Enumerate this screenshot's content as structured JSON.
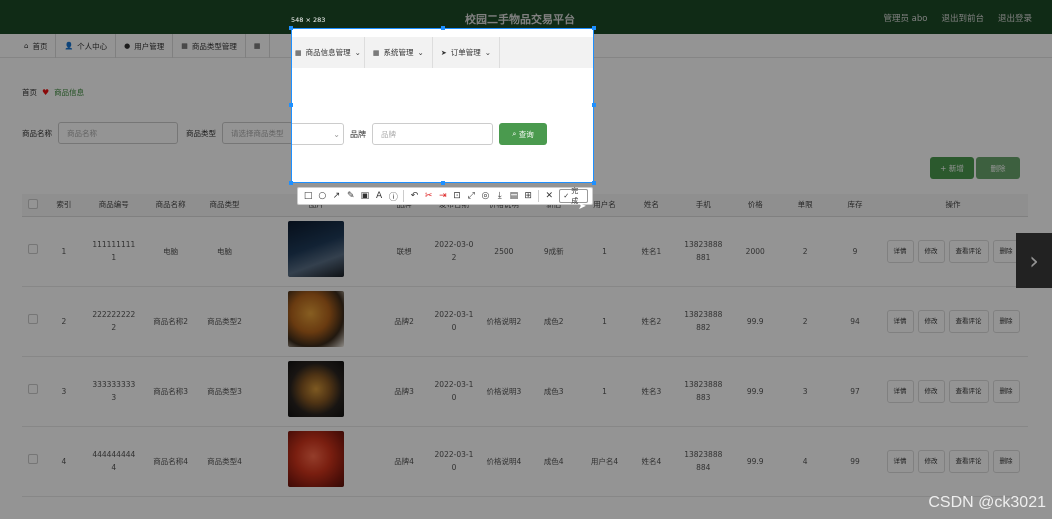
{
  "app": {
    "title": "校园二手物品交易平台",
    "admin_label": "管理员 abo",
    "exit_front_label": "退出到前台",
    "logout_label": "退出登录"
  },
  "nav": {
    "items": [
      {
        "icon": "⌂",
        "label": "首页"
      },
      {
        "icon": "👤",
        "label": "个人中心"
      },
      {
        "icon": "●",
        "label": "用户管理"
      },
      {
        "icon": "▦",
        "label": "商品类型管理"
      },
      {
        "icon": "▦",
        "label": "商品信息管理"
      },
      {
        "icon": "▦",
        "label": "系统管理"
      },
      {
        "icon": "➤",
        "label": "订单管理"
      }
    ]
  },
  "breadcrumb": {
    "home": "首页",
    "current": "商品信息"
  },
  "search": {
    "name_label": "商品名称",
    "name_placeholder": "商品名称",
    "type_label": "商品类型",
    "type_placeholder": "请选择商品类型",
    "brand_label": "品牌",
    "brand_placeholder": "品牌",
    "query_label": "查询"
  },
  "actions": {
    "add_label": "+ 新增",
    "delete_label": "删除"
  },
  "table": {
    "headers": [
      "",
      "索引",
      "商品编号",
      "商品名称",
      "商品类型",
      "图片",
      "品牌",
      "发布日期",
      "价格说明",
      "新旧",
      "用户名",
      "姓名",
      "手机",
      "价格",
      "单限",
      "库存",
      "操作"
    ],
    "rows": [
      {
        "idx": "1",
        "no": "111111111\n1",
        "name": "电脑",
        "type": "电脑",
        "brand": "联想",
        "date": "2022-03-0\n2",
        "price_desc": "2500",
        "cond": "9成新",
        "user": "1",
        "realname": "姓名1",
        "phone": "13823888\n881",
        "price": "2000",
        "limit": "2",
        "stock": "9"
      },
      {
        "idx": "2",
        "no": "222222222\n2",
        "name": "商品名称2",
        "type": "商品类型2",
        "brand": "品牌2",
        "date": "2022-03-1\n0",
        "price_desc": "价格说明2",
        "cond": "成色2",
        "user": "1",
        "realname": "姓名2",
        "phone": "13823888\n882",
        "price": "99.9",
        "limit": "2",
        "stock": "94"
      },
      {
        "idx": "3",
        "no": "333333333\n3",
        "name": "商品名称3",
        "type": "商品类型3",
        "brand": "品牌3",
        "date": "2022-03-1\n0",
        "price_desc": "价格说明3",
        "cond": "成色3",
        "user": "1",
        "realname": "姓名3",
        "phone": "13823888\n883",
        "price": "99.9",
        "limit": "3",
        "stock": "97"
      },
      {
        "idx": "4",
        "no": "444444444\n4",
        "name": "商品名称4",
        "type": "商品类型4",
        "brand": "品牌4",
        "date": "2022-03-1\n0",
        "price_desc": "价格说明4",
        "cond": "成色4",
        "user": "用户名4",
        "realname": "姓名4",
        "phone": "13823888\n884",
        "price": "99.9",
        "limit": "4",
        "stock": "99"
      }
    ],
    "row_ops": {
      "detail": "详情",
      "edit": "修改",
      "review": "查看评论",
      "delete": "删除"
    }
  },
  "snip": {
    "size_label": "548 × 283",
    "done_label": "完成",
    "sel_nav": [
      {
        "icon": "▦",
        "label": "商品信息管理"
      },
      {
        "icon": "▦",
        "label": "系统管理"
      },
      {
        "icon": "➤",
        "label": "订单管理"
      }
    ],
    "tools": [
      "□",
      "○",
      "↗",
      "✎",
      "▣",
      "A",
      "ⓘ",
      "↶",
      "✂",
      "⇥",
      "⊡",
      "⤢",
      "◎",
      "⤓",
      "▤",
      "⊞"
    ]
  },
  "watermark": "CSDN @ck3021"
}
